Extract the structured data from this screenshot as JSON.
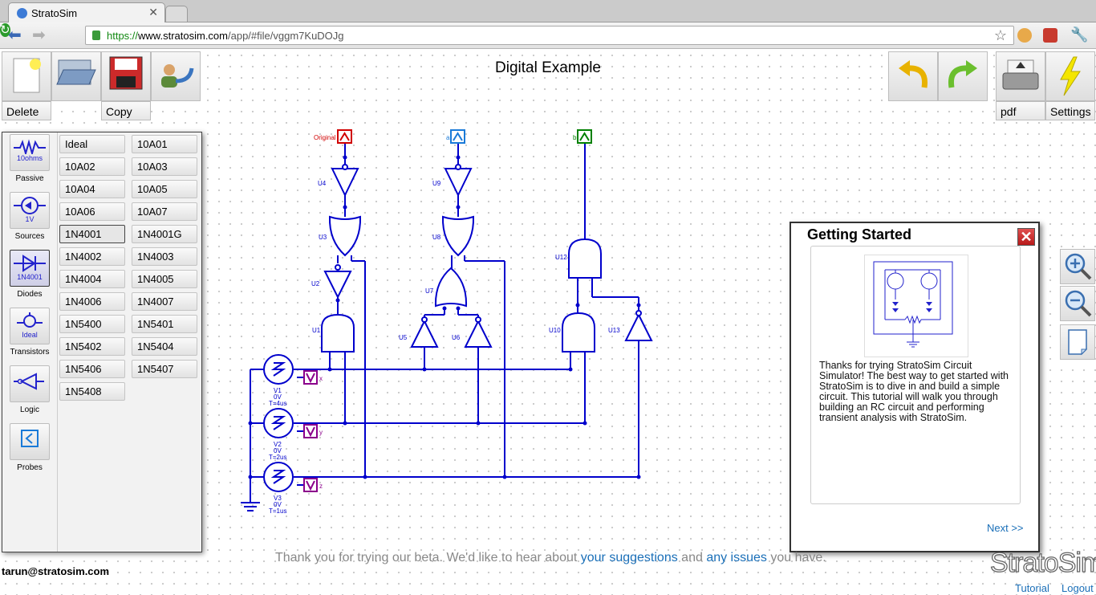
{
  "browser": {
    "tab_title": "StratoSim",
    "url_scheme": "https://",
    "url_host": "www.stratosim.com",
    "url_path": "/app/#file/vggm7KuDOJg"
  },
  "toolbar": {
    "delete_label": "Delete",
    "copy_label": "Copy",
    "pdf_label": "pdf",
    "settings_label": "Settings"
  },
  "document": {
    "title": "Digital Example"
  },
  "palette": {
    "categories": [
      {
        "label": "Passive",
        "icon_text": "10ohms",
        "icon": "resistor-icon"
      },
      {
        "label": "Sources",
        "icon_text": "1V",
        "icon": "voltage-source-icon"
      },
      {
        "label": "Diodes",
        "icon_text": "1N4001",
        "icon": "diode-icon"
      },
      {
        "label": "Transistors",
        "icon_text": "Ideal",
        "icon": "transistor-icon"
      },
      {
        "label": "Logic",
        "icon_text": "",
        "icon": "logic-gate-icon"
      },
      {
        "label": "Probes",
        "icon_text": "",
        "icon": "probe-icon"
      }
    ],
    "parts": [
      "Ideal",
      "10A01",
      "10A02",
      "10A03",
      "10A04",
      "10A05",
      "10A06",
      "10A07",
      "1N4001",
      "1N4001G",
      "1N4002",
      "1N4003",
      "1N4004",
      "1N4005",
      "1N4006",
      "1N4007",
      "1N5400",
      "1N5401",
      "1N5402",
      "1N5404",
      "1N5406",
      "1N5407",
      "1N5408"
    ]
  },
  "schematic": {
    "probe_labels": [
      "Original",
      "a",
      "b"
    ],
    "gate_labels": [
      "U4",
      "U3",
      "U2",
      "U1",
      "U9",
      "U8",
      "U7",
      "U5",
      "U6",
      "U12",
      "U10",
      "U13"
    ],
    "sources": [
      {
        "name": "V1",
        "v": "0V",
        "period": "T=4us",
        "probe": "x"
      },
      {
        "name": "V2",
        "v": "0V",
        "period": "T=2us",
        "probe": "y"
      },
      {
        "name": "V3",
        "v": "0V",
        "period": "T=1us",
        "probe": "z"
      }
    ]
  },
  "dialog": {
    "title": "Getting Started",
    "body": "Thanks for trying StratoSim Circuit Simulator! The best way to get started with StratoSim is to dive in and build a simple circuit. This tutorial will walk you through building an RC circuit and performing transient analysis with StratoSim.",
    "next_label": "Next >>"
  },
  "footer": {
    "beta_prefix": "Thank you for trying our beta. We'd like to hear about ",
    "suggestions_link": "your suggestions",
    "beta_and": " and ",
    "issues_link": "any issues",
    "beta_suffix": " you have.",
    "user_email": "tarun@stratosim.com",
    "brand": "StratoSim",
    "tutorial_link": "Tutorial",
    "logout_link": "Logout"
  },
  "colors": {
    "wire": "#0000cc",
    "probe_original": "#d00000",
    "probe_a": "#1a7ad8",
    "probe_b": "#008000",
    "probe_xyz": "#8b008b",
    "link": "#1a6fb8"
  }
}
